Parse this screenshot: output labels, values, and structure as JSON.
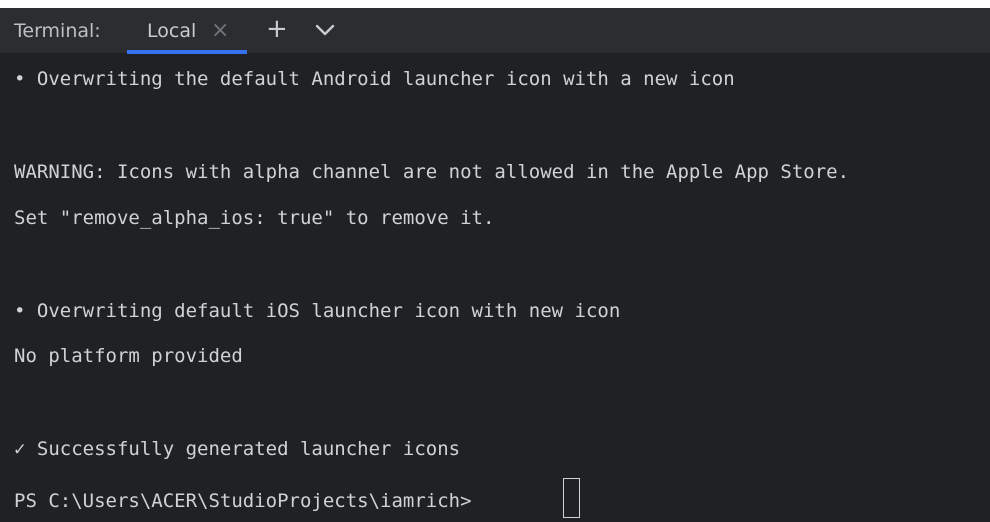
{
  "tabbar": {
    "title": "Terminal:",
    "tab_label": "Local",
    "close_glyph": "×",
    "add_glyph": "+",
    "menu_icon": "chevron-down-icon",
    "accent": "#3573f0"
  },
  "terminal": {
    "lines": [
      "• Overwriting the default Android launcher icon with a new icon",
      "WARNING: Icons with alpha channel are not allowed in the Apple App Store.",
      "Set \"remove_alpha_ios: true\" to remove it.",
      "• Overwriting default iOS launcher icon with new icon",
      "No platform provided",
      "✓ Successfully generated launcher icons"
    ],
    "prompt": "PS C:\\Users\\ACER\\StudioProjects\\iamrich>"
  }
}
